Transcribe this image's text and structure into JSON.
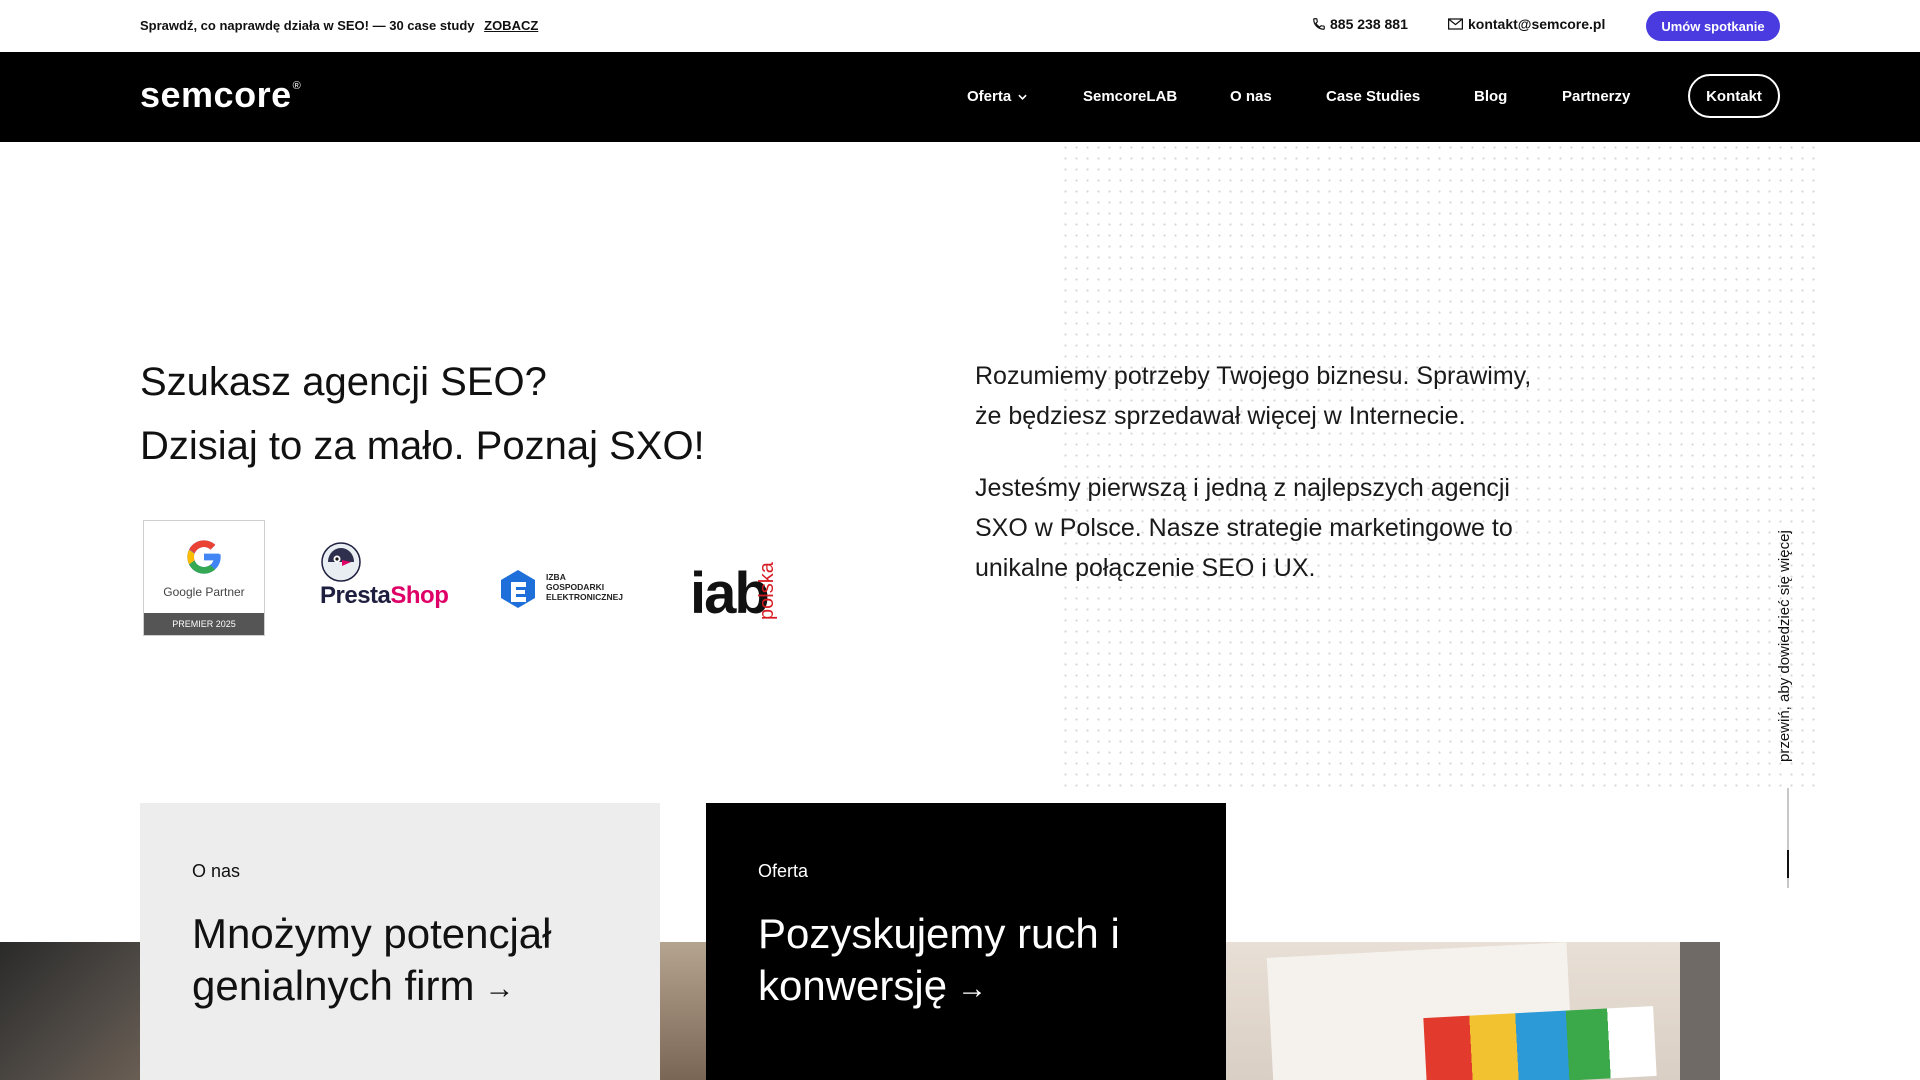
{
  "topbar": {
    "promo_text": "Sprawdź, co naprawdę działa w SEO! — 30 case study",
    "promo_link": "ZOBACZ",
    "phone": "885 238 881",
    "email": "kontakt@semcore.pl",
    "meeting_button": "Umów spotkanie",
    "meeting_button_color": "#4a3be0"
  },
  "nav": {
    "logo": "semcore",
    "logo_mark": "®",
    "items": [
      {
        "label": "Oferta",
        "has_dropdown": true
      },
      {
        "label": "SemcoreLAB"
      },
      {
        "label": "O nas"
      },
      {
        "label": "Case Studies"
      },
      {
        "label": "Blog"
      },
      {
        "label": "Partnerzy"
      }
    ],
    "contact_button": "Kontakt"
  },
  "hero": {
    "title_line1": "Szukasz agencji SEO?",
    "title_line2": "Dzisiaj to za mało. Poznaj SXO!",
    "paragraph1": "Rozumiemy potrzeby Twojego biznesu. Sprawimy, że będziesz sprzedawał więcej w Internecie.",
    "paragraph2": "Jesteśmy pierwszą i jedną z najlepszych agencji SXO w Polsce. Nasze strategie marketingowe to unikalne połączenie SEO i UX."
  },
  "badges": {
    "google_partner": "Google Partner",
    "google_premier": "PREMIER 2025",
    "prestashop_a": "Presta",
    "prestashop_b": "Shop",
    "izba_line1": "IZBA",
    "izba_line2": "GOSPODARKI",
    "izba_line3": "ELEKTRONICZNEJ",
    "iab": "iab",
    "iab_sub": "polska"
  },
  "scroll_hint": "przewiń, aby dowiedzieć się więcej",
  "cards": [
    {
      "label": "O nas",
      "title": "Mnożymy potencjał genialnych firm",
      "arrow": "→"
    },
    {
      "label": "Oferta",
      "title": "Pozyskujemy ruch i konwersję",
      "arrow": "→"
    }
  ]
}
